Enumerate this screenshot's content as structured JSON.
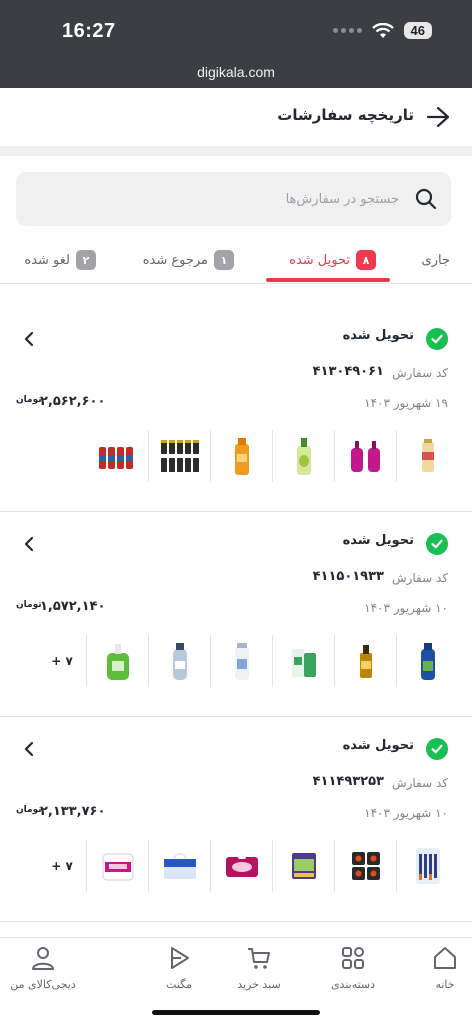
{
  "status_bar": {
    "time": "16:27",
    "battery": "46"
  },
  "browser": {
    "url": "digikala.com"
  },
  "header": {
    "title": "تاریخچه سفارشات"
  },
  "search": {
    "placeholder": "جستجو در سفارش‌ها"
  },
  "tabs": [
    {
      "label": "جاری",
      "count": ""
    },
    {
      "label": "تحویل شده",
      "count": "۸",
      "active": true
    },
    {
      "label": "مرجوع شده",
      "count": "۱"
    },
    {
      "label": "لغو شده",
      "count": "۲"
    }
  ],
  "orders": [
    {
      "status": "تحویل شده",
      "code_label": "کد سفارش",
      "code": "۴۱۳۰۴۹۰۶۱",
      "date": "۱۹ شهریور ۱۴۰۳",
      "price": "۲,۵۶۲,۶۰۰",
      "currency": "تومان",
      "products": [
        "candy-bottle",
        "pink-bottles",
        "dish-soap",
        "orange-bottle",
        "batteries",
        "spray-cans"
      ],
      "more": ""
    },
    {
      "status": "تحویل شده",
      "code_label": "کد سفارش",
      "code": "۴۱۱۵۰۱۹۳۳",
      "date": "۱۰ شهریور ۱۴۰۳",
      "price": "۱,۵۷۲,۱۴۰",
      "currency": "تومان",
      "products": [
        "shampoo-blue",
        "oil-bottle",
        "cream-tube",
        "baby-powder",
        "lotion-bottle",
        "hand-soap"
      ],
      "more": "+ ۷"
    },
    {
      "status": "تحویل شده",
      "code_label": "کد سفارش",
      "code": "۴۱۱۴۹۳۲۵۳",
      "date": "۱۰ شهریور ۱۴۰۳",
      "price": "۲,۱۳۳,۷۶۰",
      "currency": "تومان",
      "products": [
        "razors",
        "snack-pack",
        "pads-pack",
        "tissue-pink",
        "tissue-blue",
        "tissue-roll"
      ],
      "more": "+ ۷"
    }
  ],
  "bottom_nav": [
    {
      "label": "خانه",
      "icon": "home-icon"
    },
    {
      "label": "دسته‌بندی",
      "icon": "category-icon"
    },
    {
      "label": "سبد خرید",
      "icon": "cart-icon"
    },
    {
      "label": "مگنت",
      "icon": "magnet-icon"
    },
    {
      "label": "دیجی‌کالای من",
      "icon": "user-icon"
    }
  ],
  "colors": {
    "accent": "#ef394e",
    "success": "#19bf53",
    "topbar": "#3b3e42"
  }
}
